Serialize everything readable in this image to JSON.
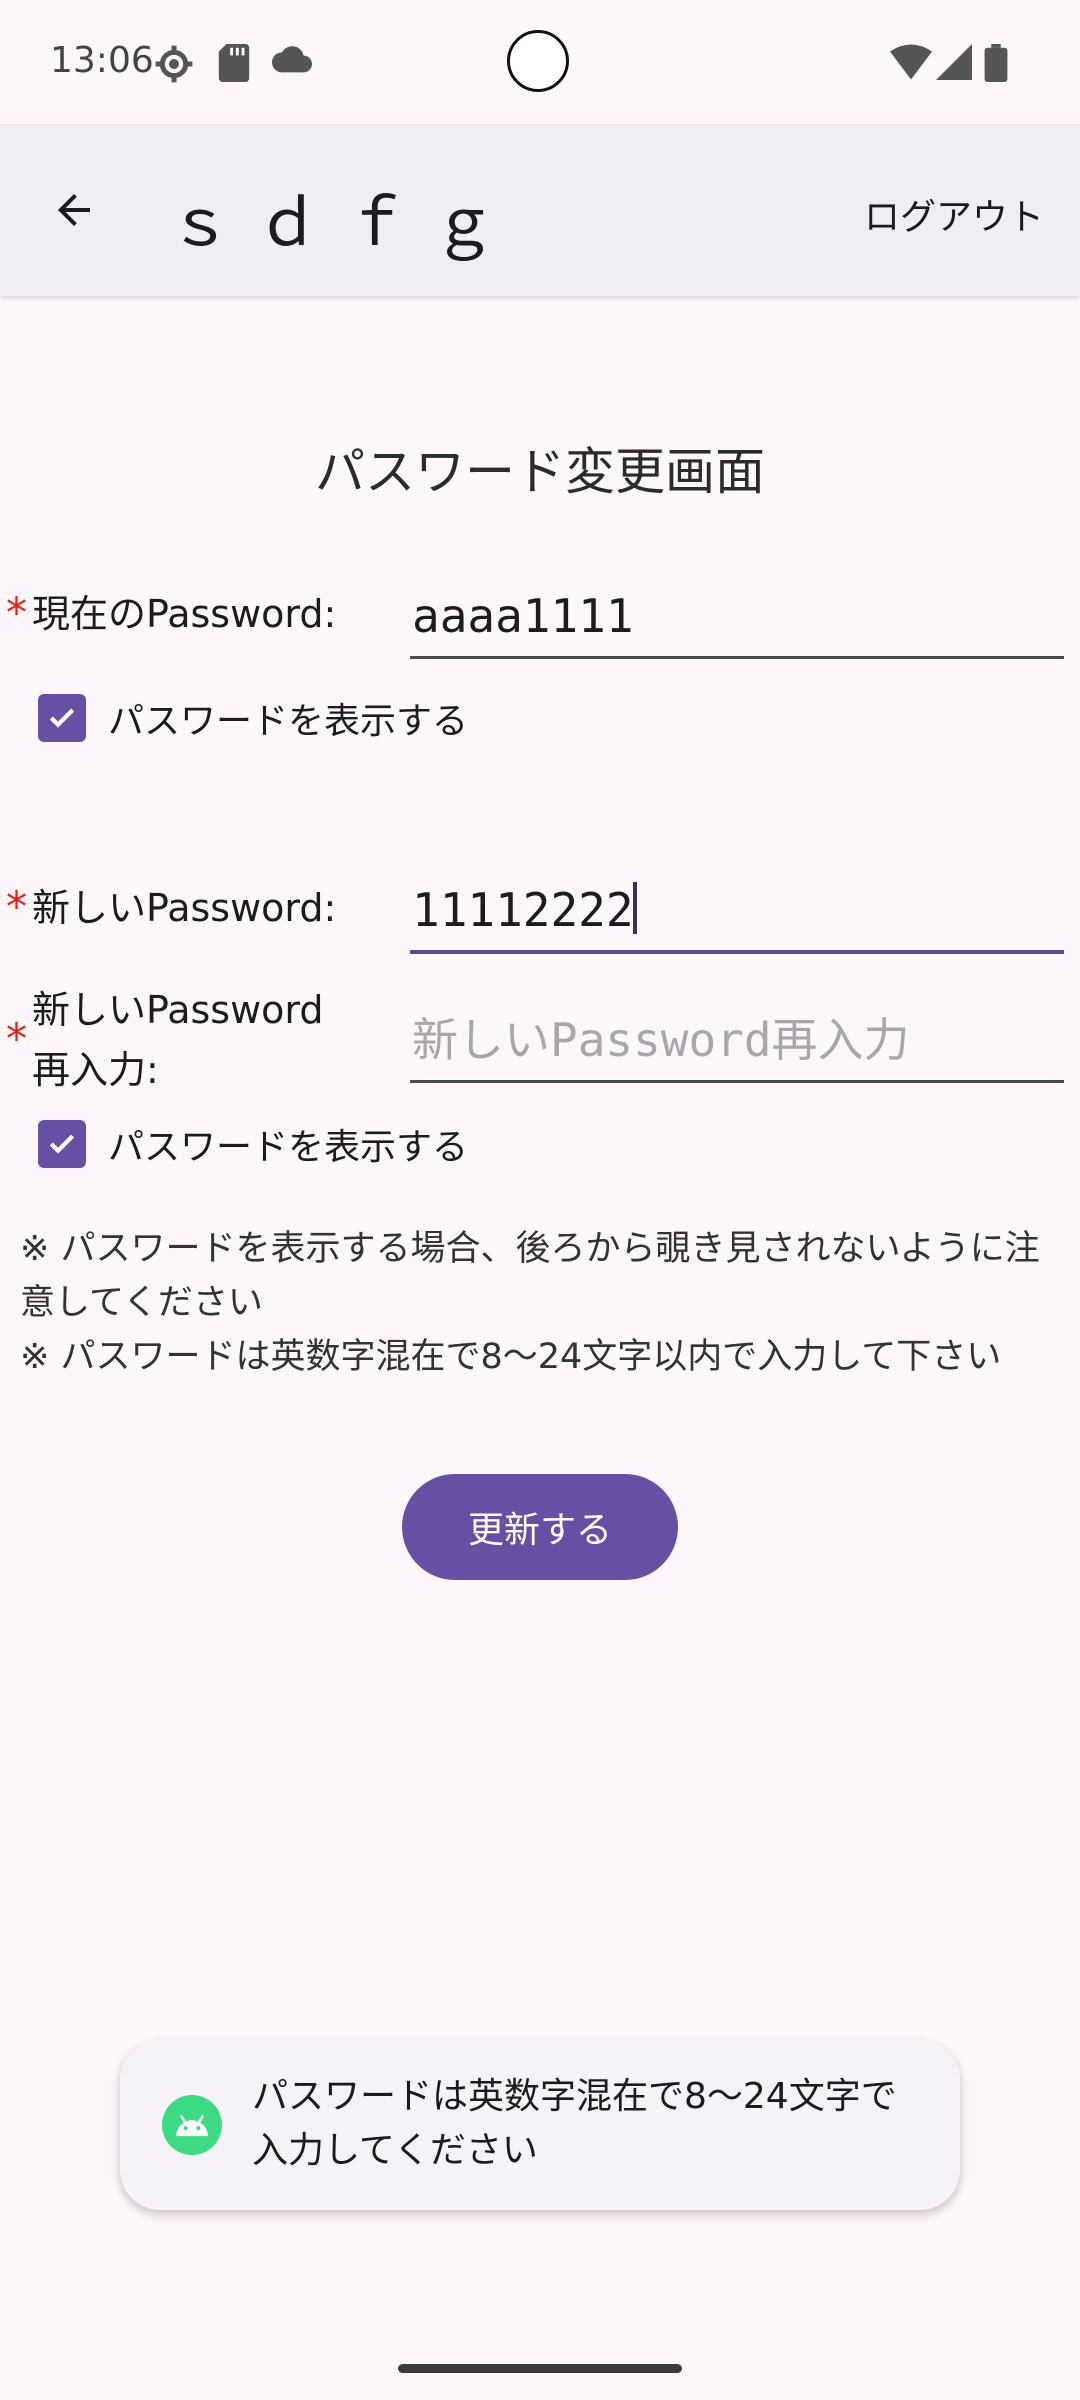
{
  "status_bar": {
    "time": "13:06",
    "icons": [
      "settings-gear-icon",
      "sd-card-icon",
      "cloud-icon",
      "wifi-icon",
      "cellular-signal-icon",
      "battery-icon"
    ]
  },
  "app_bar": {
    "title": "ｓｄｆｇ",
    "logout_label": "ログアウト"
  },
  "page": {
    "heading": "パスワード変更画面",
    "current_password": {
      "label": "現在のPassword:",
      "value": "aaaa1111"
    },
    "show_password_1": {
      "label": "パスワードを表示する",
      "checked": true
    },
    "new_password": {
      "label": "新しいPassword:",
      "value": "11112222"
    },
    "new_password_confirm": {
      "label_line1": "新しいPassword",
      "label_line2": "再入力:",
      "value": "",
      "placeholder": "新しいPassword再入力"
    },
    "show_password_2": {
      "label": "パスワードを表示する",
      "checked": true
    },
    "required_mark": "*",
    "notes": [
      "※ パスワードを表示する場合、後ろから覗き見されないように注意してください",
      "※ パスワードは英数字混在で8〜24文字以内で入力して下さい"
    ],
    "update_button": "更新する"
  },
  "toast": {
    "icon": "android-icon",
    "message": "パスワードは英数字混在で8〜24文字で入力してください"
  },
  "colors": {
    "accent": "#6750a4",
    "required": "#e0241b",
    "background": "#fdf7fb",
    "app_bar": "#f1eef3"
  }
}
